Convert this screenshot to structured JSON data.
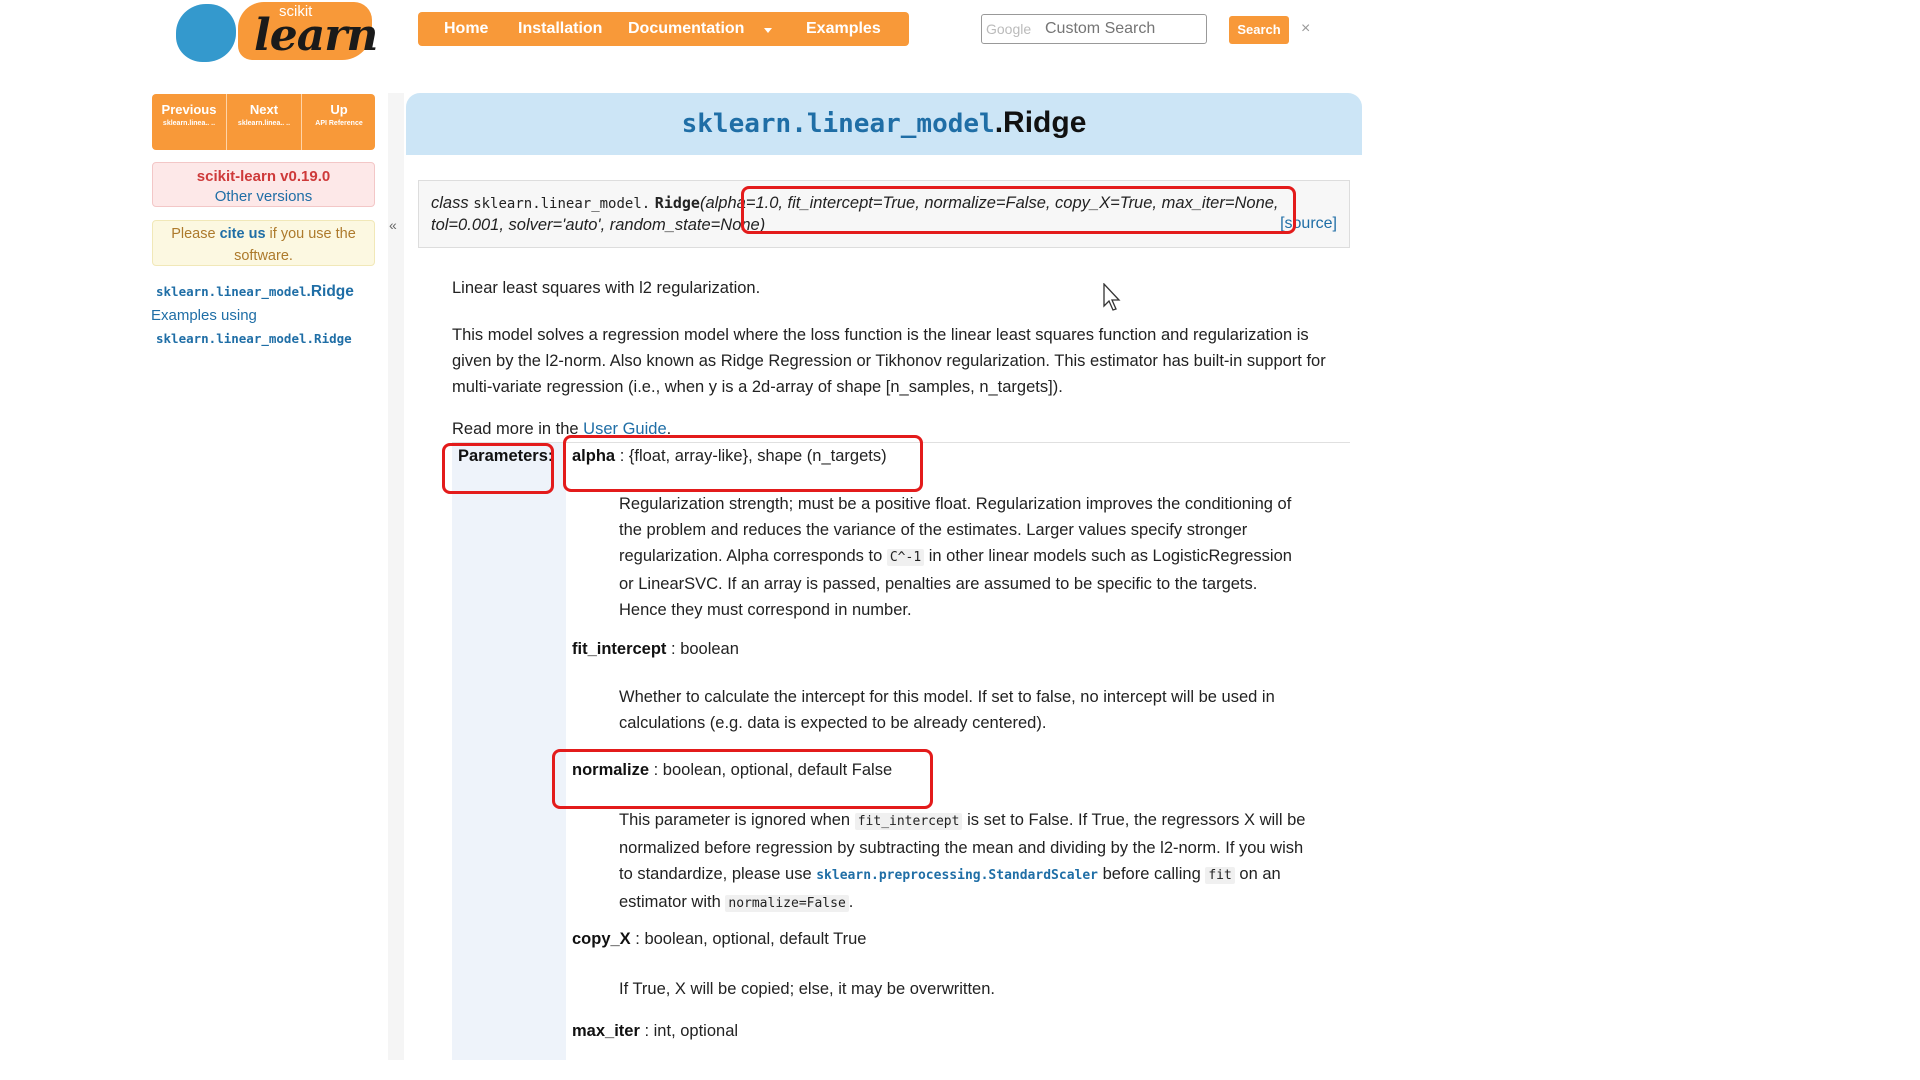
{
  "logo": {
    "top": "scikit",
    "main": "learn"
  },
  "nav": {
    "items": [
      "Home",
      "Installation",
      "Documentation",
      "Examples"
    ]
  },
  "search": {
    "engine": "Google",
    "placeholder": "Custom Search",
    "button": "Search",
    "clear": "×"
  },
  "sidebar": {
    "relnav": [
      {
        "label": "Previous",
        "sub": "sklearn.linea.. .."
      },
      {
        "label": "Next",
        "sub": "sklearn.linea.. .."
      },
      {
        "label": "Up",
        "sub": "API Reference"
      }
    ],
    "version": "scikit-learn v0.19.0",
    "other_versions": "Other versions",
    "cite_pre": "Please",
    "cite_link": "cite us",
    "cite_post": "if you use the software.",
    "link1_module": "sklearn.linear_model",
    "link1_class": ".Ridge",
    "link2": "Examples using",
    "link3": "sklearn.linear_model.Ridge",
    "collapse": "«"
  },
  "page": {
    "title_module": "sklearn.linear_model",
    "title_class": ".Ridge",
    "sig_kw": "class",
    "sig_path": "sklearn.linear_model.",
    "sig_name": "Ridge",
    "sig_line1": "(alpha=1.0, fit_intercept=True, normalize=False, copy_X=True, max_iter=None,",
    "sig_line2": "tol=0.001, solver='auto', random_state=None)",
    "source": "[source]",
    "summary": "Linear least squares with l2 regularization.",
    "description": "This model solves a regression model where the loss function is the linear least squares function and regularization is given by the l2-norm. Also known as Ridge Regression or Tikhonov regularization. This estimator has built-in support for multi-variate regression (i.e., when y is a 2d-array of shape [n_samples, n_targets]).",
    "read_more_pre": "Read more in the",
    "read_more_link": "User Guide",
    "read_more_post": ".",
    "params_label": "Parameters:",
    "params": {
      "alpha_name": "alpha",
      "alpha_type": " : {float, array-like}, shape (n_targets)",
      "alpha_desc_1": "Regularization strength; must be a positive float. Regularization improves the conditioning of the problem and reduces the variance of the estimates. Larger values specify stronger regularization. Alpha corresponds to",
      "alpha_code": "C^-1",
      "alpha_desc_2": "in other linear models such as LogisticRegression or LinearSVC. If an array is passed, penalties are assumed to be specific to the targets. Hence they must correspond in number.",
      "fit_name": "fit_intercept",
      "fit_type": " : boolean",
      "fit_desc": "Whether to calculate the intercept for this model. If set to false, no intercept will be used in calculations (e.g. data is expected to be already centered).",
      "norm_name": "normalize",
      "norm_type": " : boolean, optional, default False",
      "norm_desc_1": "This parameter is ignored when",
      "norm_code_1": "fit_intercept",
      "norm_desc_2": "is set to False. If True, the regressors X will be normalized before regression by subtracting the mean and dividing by the l2-norm. If you wish to standardize, please use",
      "norm_link": "sklearn.preprocessing.StandardScaler",
      "norm_desc_3": "before calling",
      "norm_code_2": "fit",
      "norm_desc_4": "on an estimator with",
      "norm_code_3": "normalize=False",
      "norm_desc_5": ".",
      "copy_name": "copy_X",
      "copy_type": " : boolean, optional, default True",
      "copy_desc": "If True, X will be copied; else, it may be overwritten.",
      "maxiter_name": "max_iter",
      "maxiter_type": " : int, optional"
    }
  },
  "colors": {
    "accent": "#f89939",
    "link": "#1f6ea6",
    "highlight": "#e31b1b",
    "title_band": "#cce5f6"
  }
}
